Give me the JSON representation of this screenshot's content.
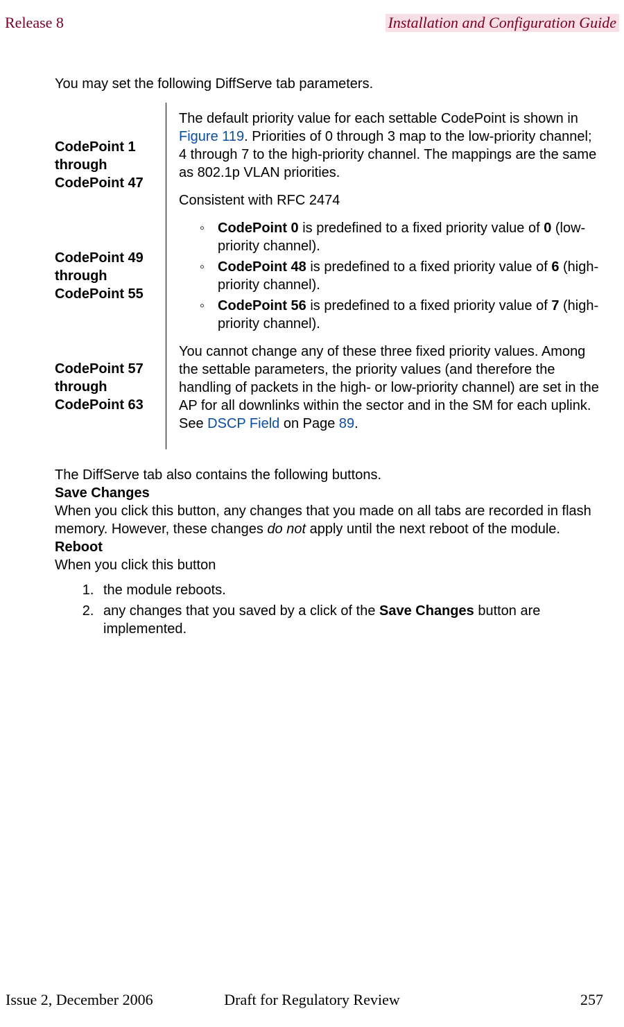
{
  "header": {
    "left": "Release 8",
    "right": "Installation and Configuration Guide"
  },
  "intro": {
    "p1": "You may set the following DiffServe tab parameters."
  },
  "lefts": {
    "r1": "CodePoint 1 through CodePoint 47",
    "r2": "CodePoint 49 through CodePoint 55",
    "r3": "CodePoint 57 through CodePoint 63"
  },
  "right": {
    "p1a": "The default priority value for each settable CodePoint is shown in ",
    "p1link": "Figure 119",
    "p1b": ". Priorities of 0 through 3 map to the low-priority channel; 4 through 7 to the high-priority channel. The mappings are the same as 802.1p VLAN priorities.",
    "p2": "Consistent with RFC 2474",
    "li1_b": "CodePoint 0",
    "li1_mid": " is predefined to a fixed priority value of ",
    "li1_val": "0",
    "li1_tail": " (low-priority channel).",
    "li2_b": "CodePoint 48",
    "li2_mid": " is predefined to a fixed priority value of ",
    "li2_val": "6",
    "li2_tail": " (high-priority channel).",
    "li3_b": "CodePoint 56",
    "li3_mid": " is predefined to a fixed priority value of ",
    "li3_val": "7",
    "li3_tail": " (high-priority channel).",
    "p3a": "You cannot change any of these three fixed priority values. Among the settable parameters, the priority values (and therefore the handling of packets in the high- or low-priority channel) are set in the AP for all downlinks within the sector and in the SM for each uplink. See ",
    "p3link": "DSCP Field",
    "p3b": " on Page ",
    "p3page": "89",
    "p3c": "."
  },
  "mid": {
    "p1": "The DiffServe tab also contains the following buttons."
  },
  "save": {
    "head": "Save Changes",
    "body_a": "When you click this button, any changes that you made on all tabs are recorded in flash memory. However, these changes ",
    "body_em": "do not",
    "body_b": " apply until the next reboot of the module."
  },
  "reboot": {
    "head": "Reboot",
    "lead": "When you click this button",
    "li1": "the module reboots.",
    "li2_a": "any changes that you saved by a click of the ",
    "li2_b": "Save Changes",
    "li2_c": " button are implemented."
  },
  "footer": {
    "left": "Issue 2, December 2006",
    "center": "Draft for Regulatory Review",
    "right": "257"
  }
}
